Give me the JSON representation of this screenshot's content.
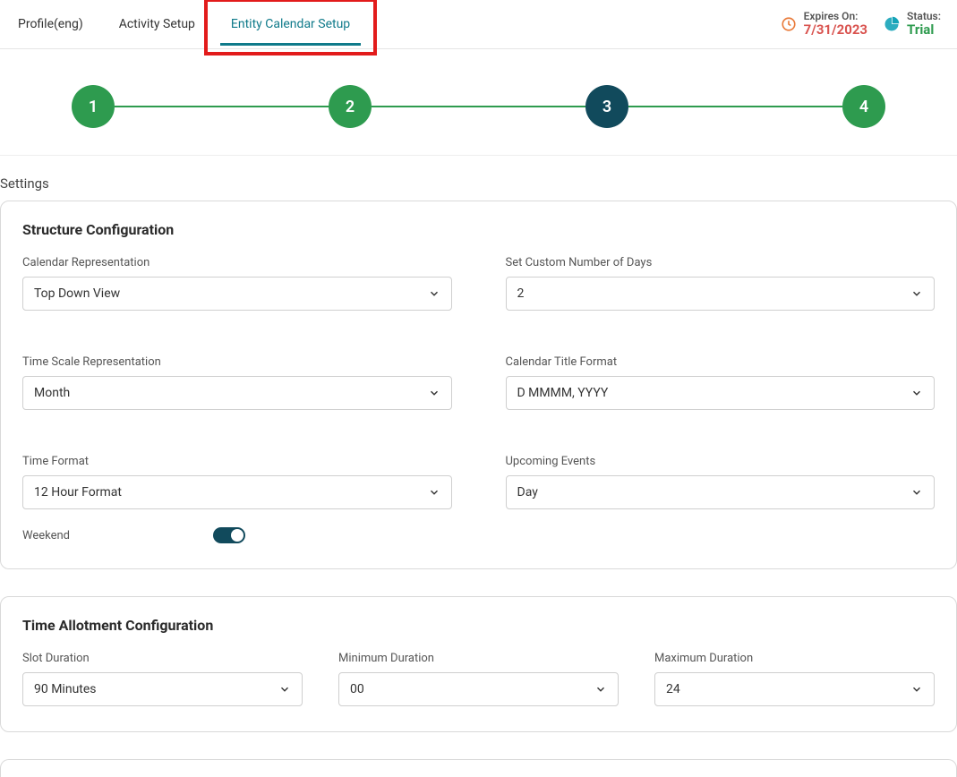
{
  "tabs": {
    "profile": "Profile(eng)",
    "activity": "Activity Setup",
    "entity": "Entity Calendar Setup"
  },
  "status": {
    "expires_label": "Expires On:",
    "expires_value": "7/31/2023",
    "status_label": "Status:",
    "status_value": "Trial"
  },
  "steps": [
    "1",
    "2",
    "3",
    "4"
  ],
  "settings_heading": "Settings",
  "structure": {
    "title": "Structure Configuration",
    "calendar_rep_label": "Calendar Representation",
    "calendar_rep_value": "Top Down View",
    "custom_days_label": "Set Custom Number of Days",
    "custom_days_value": "2",
    "timescale_label": "Time Scale Representation",
    "timescale_value": "Month",
    "title_format_label": "Calendar Title Format",
    "title_format_value": "D MMMM, YYYY",
    "time_format_label": "Time Format",
    "time_format_value": "12 Hour Format",
    "upcoming_label": "Upcoming Events",
    "upcoming_value": "Day",
    "weekend_label": "Weekend"
  },
  "allotment": {
    "title": "Time Allotment Configuration",
    "slot_label": "Slot Duration",
    "slot_value": "90 Minutes",
    "min_label": "Minimum Duration",
    "min_value": "00",
    "max_label": "Maximum Duration",
    "max_value": "24"
  }
}
